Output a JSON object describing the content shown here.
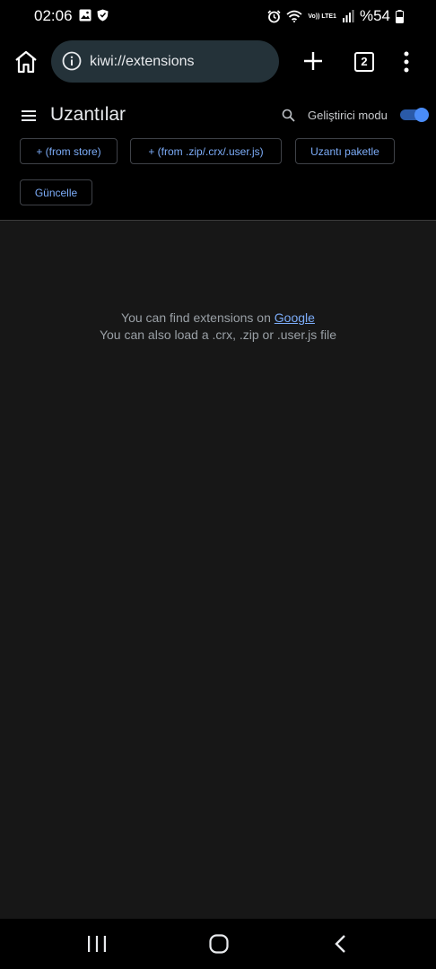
{
  "status_bar": {
    "time": "02:06",
    "icons": [
      "image-icon",
      "shield-icon",
      "alarm-icon",
      "wifi-icon",
      "volte-icon",
      "signal-icon",
      "battery-icon"
    ],
    "volte_text": "Vo)) LTE1",
    "battery": "%54"
  },
  "toolbar": {
    "url": "kiwi://extensions",
    "tab_count": "2",
    "icons": [
      "home-icon",
      "info-icon",
      "plus-icon",
      "tab-switcher-icon",
      "more-vert-icon"
    ]
  },
  "extensions_header": {
    "title": "Uzantılar",
    "dev_mode_label": "Geliştirici modu",
    "dev_mode_enabled": true,
    "buttons": {
      "from_store": "+ (from store)",
      "from_file": "+ (from .zip/.crx/.user.js)",
      "pack": "Uzantı paketle",
      "update": "Güncelle"
    }
  },
  "empty_state": {
    "line1_prefix": "You can find extensions on ",
    "line1_link": "Google",
    "line2": "You can also load a .crx, .zip or .user.js file"
  },
  "colors": {
    "accent": "#7cacf8",
    "toggle_on": "#4a8cf7",
    "omnibox_bg": "#243239",
    "content_bg": "#171717"
  }
}
